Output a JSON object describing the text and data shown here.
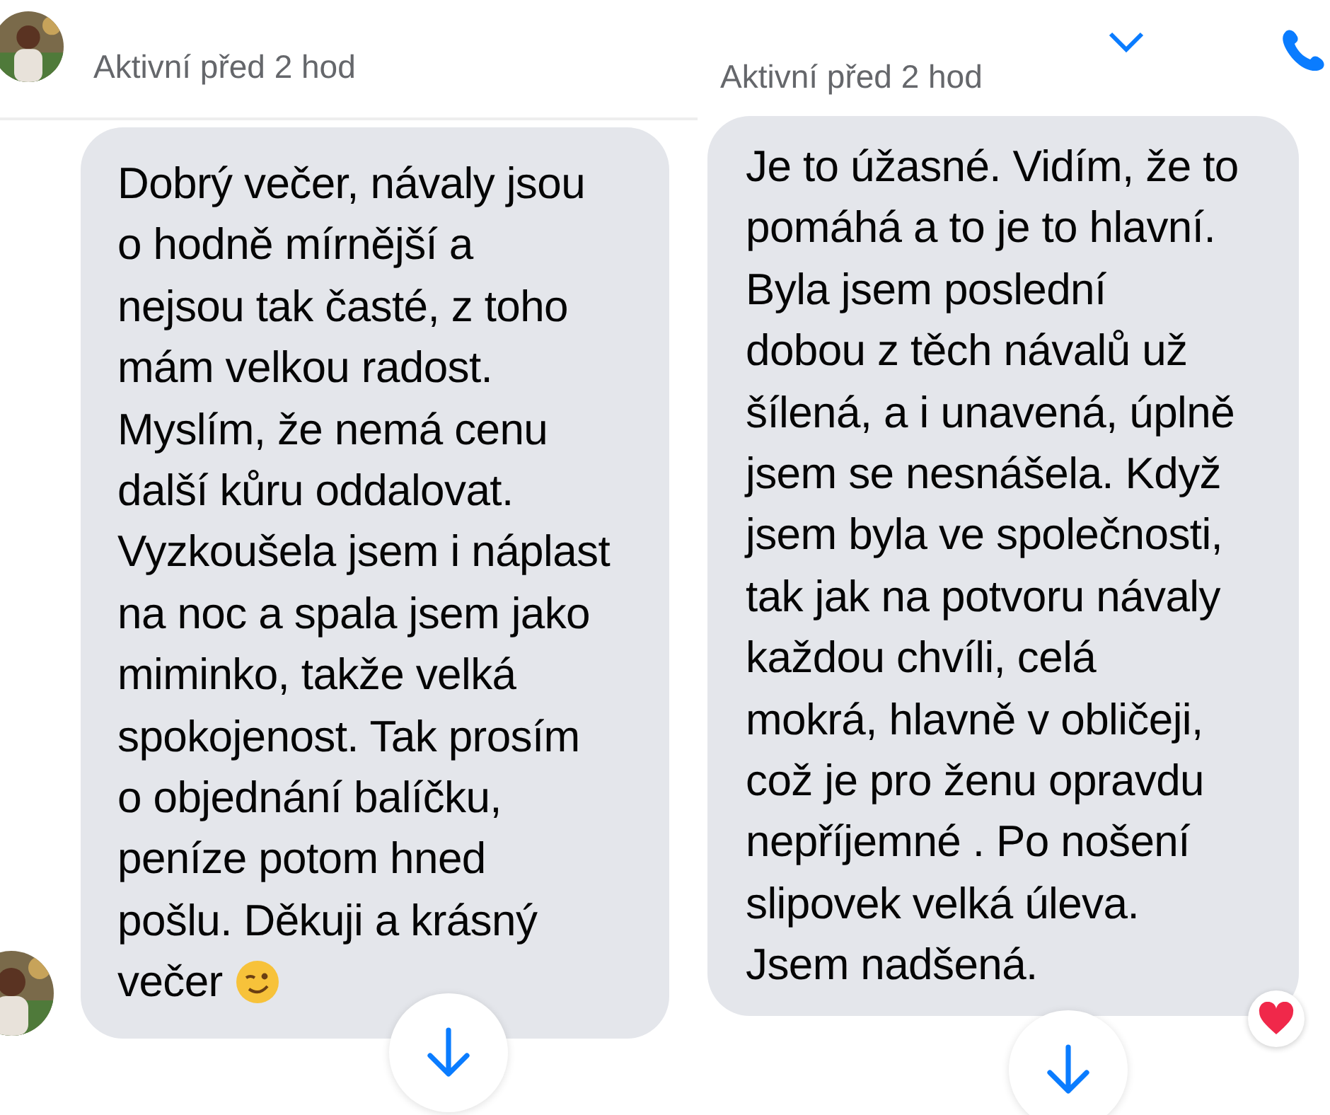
{
  "panels": [
    {
      "status": "Aktivní před 2 hod",
      "message": {
        "lines": [
          "Dobrý večer, návaly jsou",
          "o hodně mírnější a",
          "nejsou tak časté, z toho",
          "mám velkou radost.",
          "Myslím, že nemá cenu",
          "další kůru oddalovat.",
          "Vyzkoušela jsem i náplast",
          "na noc a spala jsem jako",
          "miminko, takže velká",
          "spokojenost. Tak prosím",
          "o objednání balíčku,",
          "peníze potom hned",
          "pošlu. Děkuji a krásný",
          "večer"
        ],
        "emoji": {
          "kind": "wink"
        }
      }
    },
    {
      "status": "Aktivní před 2 hod",
      "message": {
        "lines": [
          "Je to úžasné. Vidím, že to",
          "pomáhá a to je to hlavní.",
          "Byla jsem poslední",
          "dobou z těch návalů už",
          "šílená, a i unavená, úplně",
          "jsem se nesnášela. Když",
          "jsem byla ve společnosti,",
          "tak jak na potvoru návaly",
          "každou chvíli, celá",
          "mokrá, hlavně v obličeji,",
          "což je pro ženu opravdu",
          "nepříjemné . Po nošení",
          "slipovek velká úleva.",
          "Jsem nadšená."
        ],
        "reaction": {
          "kind": "heart"
        }
      },
      "actions": [
        {
          "kind": "call"
        }
      ]
    }
  ]
}
